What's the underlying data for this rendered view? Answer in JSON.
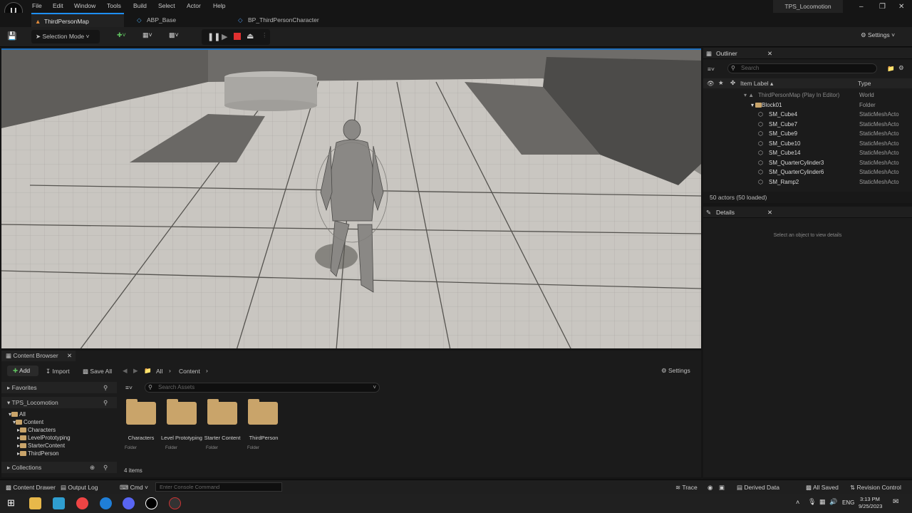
{
  "menu": [
    "File",
    "Edit",
    "Window",
    "Tools",
    "Build",
    "Select",
    "Actor",
    "Help"
  ],
  "project_name": "TPS_Locomotion",
  "tabs": [
    {
      "label": "ThirdPersonMap",
      "active": true
    },
    {
      "label": "ABP_Base",
      "active": false
    },
    {
      "label": "BP_ThirdPersonCharacter",
      "active": false
    }
  ],
  "toolbar": {
    "mode_label": "Selection Mode",
    "settings_label": "Settings"
  },
  "outliner": {
    "title": "Outliner",
    "search_placeholder": "Search",
    "col_label": "Item Label ▴",
    "col_type": "Type",
    "rows": [
      {
        "label": "ThirdPersonMap (Play In Editor)",
        "type": "World",
        "indent": 0,
        "dim": true
      },
      {
        "label": "Block01",
        "type": "Folder",
        "indent": 1
      },
      {
        "label": "SM_Cube4",
        "type": "StaticMeshActo",
        "indent": 2
      },
      {
        "label": "SM_Cube7",
        "type": "StaticMeshActo",
        "indent": 2
      },
      {
        "label": "SM_Cube9",
        "type": "StaticMeshActo",
        "indent": 2
      },
      {
        "label": "SM_Cube10",
        "type": "StaticMeshActo",
        "indent": 2
      },
      {
        "label": "SM_Cube14",
        "type": "StaticMeshActo",
        "indent": 2
      },
      {
        "label": "SM_QuarterCylinder3",
        "type": "StaticMeshActo",
        "indent": 2
      },
      {
        "label": "SM_QuarterCylinder6",
        "type": "StaticMeshActo",
        "indent": 2
      },
      {
        "label": "SM_Ramp2",
        "type": "StaticMeshActo",
        "indent": 2
      }
    ],
    "footer": "50 actors (50 loaded)"
  },
  "details": {
    "title": "Details",
    "empty_text": "Select an object to view details"
  },
  "content_browser": {
    "title": "Content Browser",
    "add_label": "Add",
    "import_label": "Import",
    "save_all_label": "Save All",
    "path": [
      "All",
      "Content"
    ],
    "settings_label": "Settings",
    "favorites_label": "Favorites",
    "project_label": "TPS_Locomotion",
    "collections_label": "Collections",
    "search_placeholder": "Search Assets",
    "tree": [
      "All",
      "Content",
      "Characters",
      "LevelPrototyping",
      "StarterContent",
      "ThirdPerson"
    ],
    "folders": [
      {
        "name": "Characters",
        "sub": "Folder"
      },
      {
        "name": "Level Prototyping",
        "sub": "Folder"
      },
      {
        "name": "Starter Content",
        "sub": "Folder"
      },
      {
        "name": "ThirdPerson",
        "sub": "Folder"
      }
    ],
    "item_count": "4 items"
  },
  "statusbar": {
    "content_drawer": "Content Drawer",
    "output_log": "Output Log",
    "cmd": "Cmd",
    "console_placeholder": "Enter Console Command",
    "trace": "Trace",
    "derived_data": "Derived Data",
    "all_saved": "All Saved",
    "revision_control": "Revision Control"
  },
  "taskbar": {
    "time": "3:13 PM",
    "date": "9/25/2023",
    "lang": "ENG"
  }
}
